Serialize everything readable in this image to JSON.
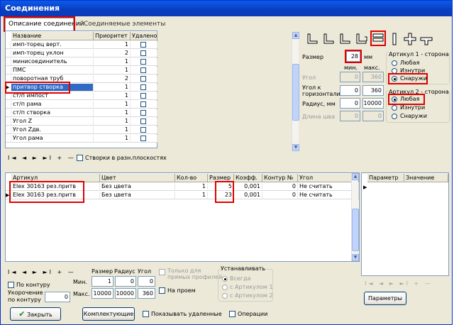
{
  "window": {
    "title": "Соединения"
  },
  "tabs": [
    {
      "label": "Описание соединений"
    },
    {
      "label": "Соединяемые элементы"
    }
  ],
  "connections_table": {
    "headers": [
      "Название",
      "Приоритет",
      "Удалено"
    ],
    "rows": [
      {
        "name": "имп-торец верт.",
        "priority": "1"
      },
      {
        "name": "имп-торец уклон",
        "priority": "2"
      },
      {
        "name": "минисоединитель",
        "priority": "1"
      },
      {
        "name": "ПМС",
        "priority": "1"
      },
      {
        "name": "поворотная труб",
        "priority": "2"
      },
      {
        "name": "притвор створка",
        "priority": "1"
      },
      {
        "name": "ст/п импост",
        "priority": "1"
      },
      {
        "name": "ст/п рама",
        "priority": "1"
      },
      {
        "name": "ст/п створка",
        "priority": "1"
      },
      {
        "name": "Угол Z",
        "priority": "1"
      },
      {
        "name": "Угол Zдв.",
        "priority": "1"
      },
      {
        "name": "Угол рама",
        "priority": "1"
      }
    ],
    "selected_index": 5
  },
  "nav_symbols": "I◄ ◄ ► ►I + —",
  "sashes_checkbox_label": "Створки в разн.плоскостях",
  "params": {
    "size_label": "Размер",
    "size_value": "28",
    "size_unit": "мм",
    "min_label": "мин.",
    "max_label": "макс.",
    "angle_label": "Угол",
    "angle_min": "0",
    "angle_max": "360",
    "horiz_label_1": "Угол к",
    "horiz_label_2": "горизонтали",
    "horiz_min": "0",
    "horiz_max": "360",
    "radius_label": "Радиус, мм",
    "radius_min": "0",
    "radius_max": "10000",
    "length_label": "Длина шва",
    "length_min": "0",
    "length_max": "0"
  },
  "article1": {
    "title": "Артикул 1 - сторона",
    "options": [
      "Любая",
      "Изнутри",
      "Снаружи"
    ],
    "selected": 2
  },
  "article2": {
    "title": "Артикул 2 - сторона",
    "options": [
      "Любая",
      "Изнутри",
      "Снаружи"
    ],
    "selected": 0
  },
  "articles_table": {
    "headers": [
      "Артикул",
      "Цвет",
      "Кол-во",
      "Размер",
      "Коэфф.",
      "Контур №",
      "Угол"
    ],
    "rows": [
      {
        "article": "Elex 30163 рез.притв",
        "color": "Без цвета",
        "qty": "1",
        "size": "5",
        "coef": "0,001",
        "contour": "0",
        "angle": "Не считать"
      },
      {
        "article": "Elex 30163 рез.притв",
        "color": "Без цвета",
        "qty": "1",
        "size": "23",
        "coef": "0,001",
        "contour": "0",
        "angle": "Не считать"
      }
    ]
  },
  "params_table": {
    "headers": [
      "Параметр",
      "Значение"
    ]
  },
  "bottom": {
    "size_header": "Размер",
    "radius_header": "Радиус",
    "angle_header": "Угол",
    "min_label": "Мин.",
    "max_label": "Макс.",
    "min_size": "1",
    "min_radius": "0",
    "min_angle": "0",
    "max_size": "10000",
    "max_radius": "10000",
    "max_angle": "360",
    "by_contour_label": "По контуру",
    "shortening_label_1": "Укорочение",
    "shortening_label_2": "по контуру",
    "shortening_value": "0",
    "straight_only_1": "Только для",
    "straight_only_2": "прямых профилей",
    "on_opening": "На проем",
    "install_title": "Устанавливать",
    "install_options": [
      "Всегда",
      "с Артикулом 1",
      "с Артикулом 2"
    ],
    "params_button": "Параметры",
    "close_button": "Закрыть",
    "kit_button": "Комплектующие",
    "show_deleted": "Показывать удаленные",
    "operations": "Операции"
  }
}
